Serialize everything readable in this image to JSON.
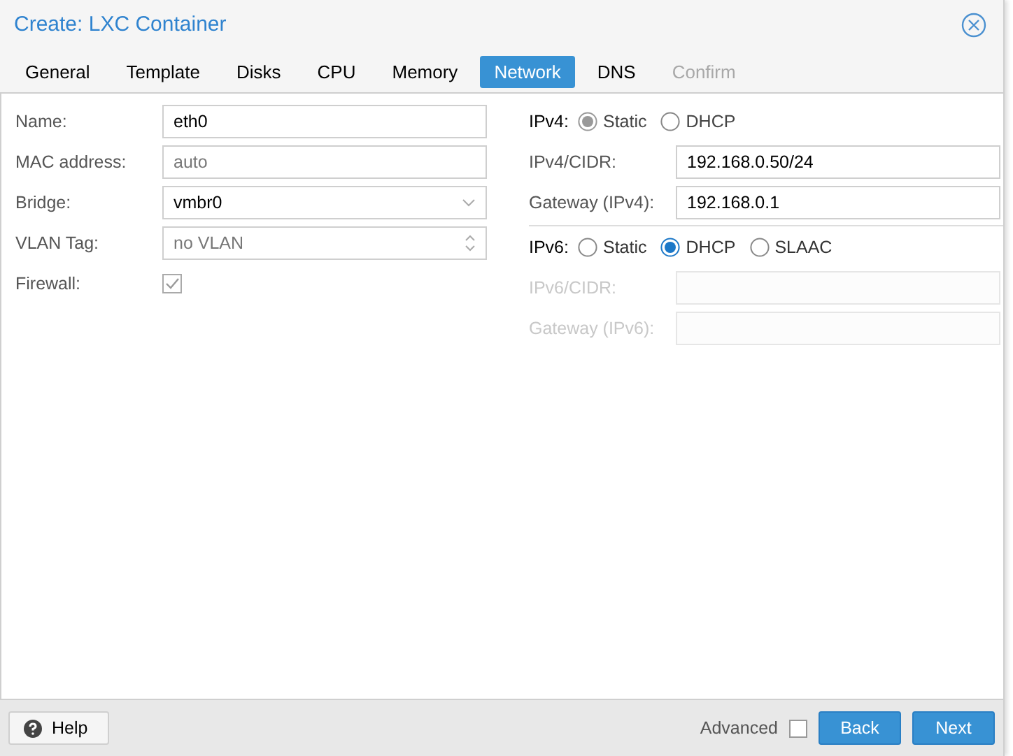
{
  "window": {
    "title": "Create: LXC Container"
  },
  "tabs": [
    {
      "label": "General",
      "selected": false,
      "disabled": false
    },
    {
      "label": "Template",
      "selected": false,
      "disabled": false
    },
    {
      "label": "Disks",
      "selected": false,
      "disabled": false
    },
    {
      "label": "CPU",
      "selected": false,
      "disabled": false
    },
    {
      "label": "Memory",
      "selected": false,
      "disabled": false
    },
    {
      "label": "Network",
      "selected": true,
      "disabled": false
    },
    {
      "label": "DNS",
      "selected": false,
      "disabled": false
    },
    {
      "label": "Confirm",
      "selected": false,
      "disabled": true
    }
  ],
  "left_fields": [
    {
      "kind": "text",
      "label": "Name:",
      "value": "eth0",
      "disabled": false
    },
    {
      "kind": "text",
      "label": "MAC address:",
      "placeholder": "auto",
      "disabled": false
    },
    {
      "kind": "combo",
      "label": "Bridge:",
      "value": "vmbr0"
    },
    {
      "kind": "spinner",
      "label": "VLAN Tag:",
      "placeholder": "no VLAN"
    },
    {
      "kind": "checkbox",
      "label": "Firewall:",
      "checked": true,
      "disabled": true
    }
  ],
  "right_fields": [
    {
      "kind": "radio",
      "label": "IPv4:",
      "disabled": true,
      "options": [
        {
          "label": "Static",
          "selected": true
        },
        {
          "label": "DHCP",
          "selected": false
        }
      ]
    },
    {
      "kind": "text",
      "label": "IPv4/CIDR:",
      "value": "192.168.0.50/24",
      "disabled": false
    },
    {
      "kind": "text",
      "label": "Gateway (IPv4):",
      "value": "192.168.0.1",
      "disabled": false
    },
    {
      "kind": "radio",
      "label": "IPv6:",
      "disabled": false,
      "options": [
        {
          "label": "Static",
          "selected": false
        },
        {
          "label": "DHCP",
          "selected": true
        },
        {
          "label": "SLAAC",
          "selected": false
        }
      ]
    },
    {
      "kind": "text",
      "label": "IPv6/CIDR:",
      "disabled": true
    },
    {
      "kind": "text",
      "label": "Gateway (IPv6):",
      "disabled": true
    }
  ],
  "footer": {
    "help": "Help",
    "advanced": {
      "label": "Advanced",
      "checked": false
    },
    "buttons": [
      "Back",
      "Next"
    ]
  }
}
